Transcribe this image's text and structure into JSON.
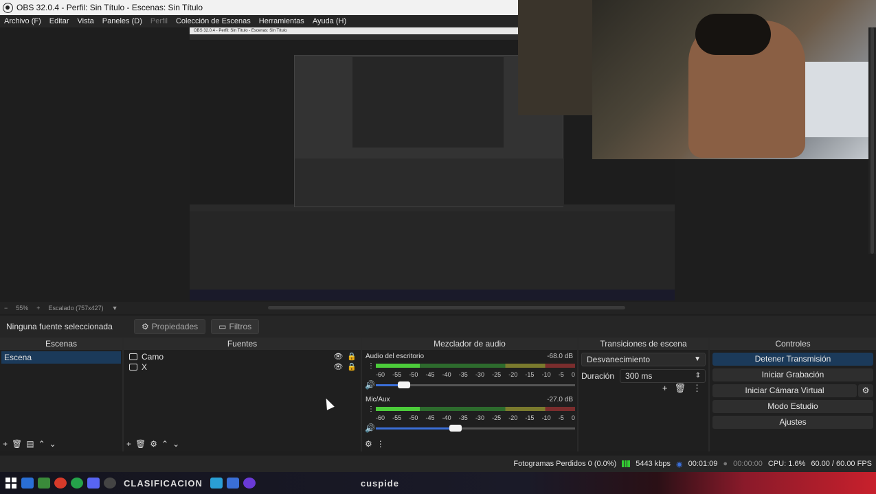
{
  "window": {
    "title": "OBS 32.0.4 - Perfil: Sin Título - Escenas: Sin Título"
  },
  "menu": [
    "Archivo (F)",
    "Editar",
    "Vista",
    "Paneles (D)",
    "Perfil",
    "Colección de Escenas",
    "Herramientas",
    "Ayuda (H)"
  ],
  "zoom": {
    "minus": "−",
    "level": "55%",
    "plus": "+",
    "scaled": "Escalado (757x427)"
  },
  "propbar": {
    "no_source": "Ninguna fuente seleccionada",
    "properties": "Propiedades",
    "filters": "Filtros"
  },
  "docks": {
    "scenes": {
      "title": "Escenas",
      "items": [
        "Escena"
      ]
    },
    "sources": {
      "title": "Fuentes",
      "items": [
        {
          "name": "Camo",
          "icon": "camera-icon"
        },
        {
          "name": "X",
          "icon": "window-capture-icon"
        }
      ]
    },
    "mixer": {
      "title": "Mezclador de audio",
      "channels": [
        {
          "name": "Audio del escritorio",
          "db": "-68.0 dB",
          "level": 0.22,
          "volume": 0.14
        },
        {
          "name": "Mic/Aux",
          "db": "-27.0 dB",
          "level": 0.22,
          "volume": 0.4
        }
      ],
      "ticks": [
        "-60",
        "-55",
        "-50",
        "-45",
        "-40",
        "-35",
        "-30",
        "-25",
        "-20",
        "-15",
        "-10",
        "-5",
        "0"
      ]
    },
    "transitions": {
      "title": "Transiciones de escena",
      "selected": "Desvanecimiento",
      "duration_label": "Duración",
      "duration_value": "300 ms"
    },
    "controls": {
      "title": "Controles",
      "buttons": [
        "Detener Transmisión",
        "Iniciar Grabación",
        "Iniciar Cámara Virtual",
        "Modo Estudio",
        "Ajustes"
      ]
    }
  },
  "status": {
    "dropped": "Fotogramas Perdidos 0 (0.0%)",
    "bitrate": "5443 kbps",
    "live_time": "00:01:09",
    "rec_time": "00:00:00",
    "cpu": "CPU: 1.6%",
    "fps": "60.00 / 60.00 FPS"
  },
  "taskbar": {
    "overlay_text": "CLASIFICACION",
    "overlay_text2": "cuspide"
  },
  "colors": {
    "accent": "#1b3a5a",
    "meter_green": "#4ccc3a"
  }
}
